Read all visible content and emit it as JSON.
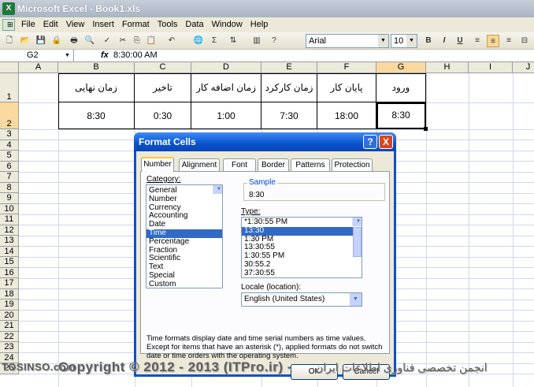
{
  "window": {
    "title": "Microsoft Excel - Book1.xls",
    "icon": "excel-icon"
  },
  "menu": [
    "File",
    "Edit",
    "View",
    "Insert",
    "Format",
    "Tools",
    "Data",
    "Window",
    "Help"
  ],
  "toolbar": {
    "font": "Arial",
    "size": "10",
    "bold": "B",
    "italic": "I",
    "underline": "U"
  },
  "formula_bar": {
    "name_box": "G2",
    "fx": "fx",
    "value": "8:30:00 AM"
  },
  "columns": [
    "A",
    "B",
    "C",
    "D",
    "E",
    "F",
    "G",
    "H",
    "I",
    "J"
  ],
  "rows": [
    "1",
    "2",
    "3",
    "4",
    "5",
    "6",
    "7",
    "8",
    "9",
    "10",
    "11",
    "12",
    "13",
    "14",
    "15",
    "16",
    "17",
    "18",
    "19",
    "20",
    "21",
    "22",
    "23",
    "24",
    "25"
  ],
  "table": {
    "headers": {
      "B": "زمان نهایی",
      "C": "تاخیر",
      "D": "زمان اضافه کار",
      "E": "زمان کارکرد",
      "F": "پایان کار",
      "G": "ورود"
    },
    "values": {
      "B": "8:30",
      "C": "0:30",
      "D": "1:00",
      "E": "7:30",
      "F": "18:00",
      "G": "8:30"
    }
  },
  "dialog": {
    "title": "Format Cells",
    "help": "?",
    "close": "X",
    "tabs": [
      "Number",
      "Alignment",
      "Font",
      "Border",
      "Patterns",
      "Protection"
    ],
    "active_tab": "Number",
    "category_label": "Category:",
    "categories": [
      "General",
      "Number",
      "Currency",
      "Accounting",
      "Date",
      "Time",
      "Percentage",
      "Fraction",
      "Scientific",
      "Text",
      "Special",
      "Custom"
    ],
    "selected_category": "Time",
    "sample_label": "Sample",
    "sample_value": "8:30",
    "type_label": "Type:",
    "types": [
      "*1:30:55 PM",
      "13:30",
      "1:30 PM",
      "13:30:55",
      "1:30:55 PM",
      "30:55.2",
      "37:30:55"
    ],
    "selected_type": "13:30",
    "locale_label": "Locale (location):",
    "locale_value": "English (United States)",
    "description": "Time formats display date and time serial numbers as time values. Except for items that have an asterisk (*), applied formats do not switch date or time orders with the operating system.",
    "ok": "OK",
    "cancel": "Cancel"
  },
  "watermark": {
    "url": "TOSINSO.com",
    "copyright": "Copyright © 2012 - 2013 (ITPro.ir) -",
    "persian": "انجمن تخصصی فناوری اطلاعات ایران"
  }
}
